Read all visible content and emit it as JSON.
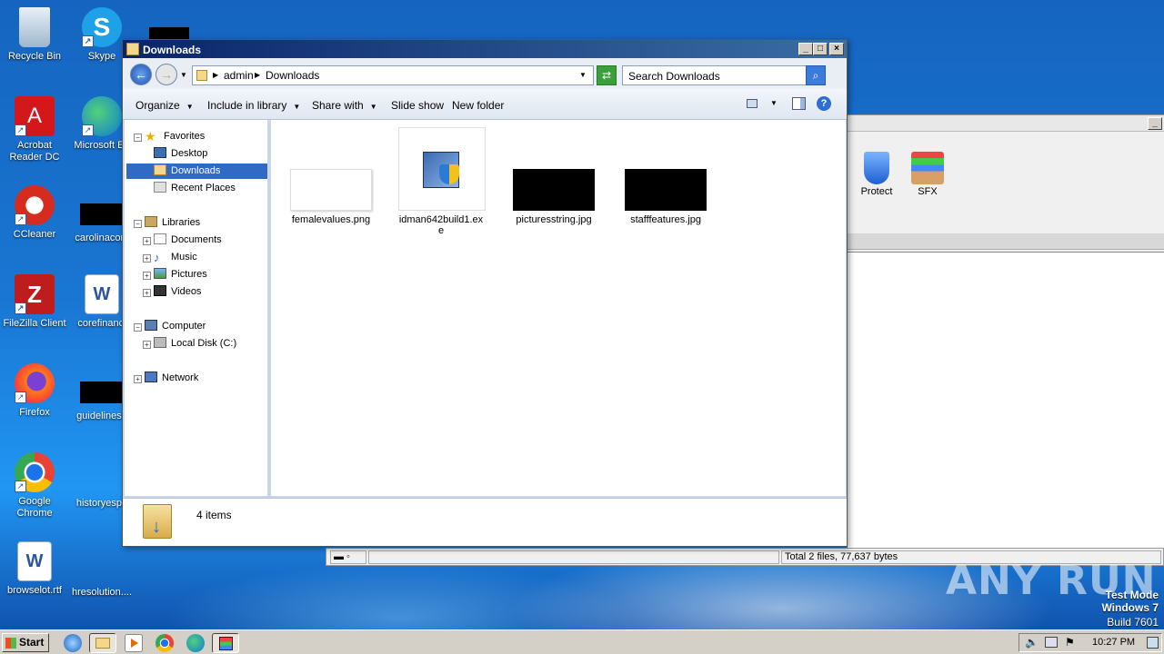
{
  "desktop": {
    "icons": [
      {
        "label": "Recycle Bin"
      },
      {
        "label": "Skype"
      },
      {
        "label": "Acrobat Reader DC"
      },
      {
        "label": "Microsoft Ed"
      },
      {
        "label": "CCleaner"
      },
      {
        "label": "carolinacom"
      },
      {
        "label": "FileZilla Client"
      },
      {
        "label": "corefinanci"
      },
      {
        "label": "Firefox"
      },
      {
        "label": "guidelinesf."
      },
      {
        "label": "Google Chrome"
      },
      {
        "label": "historyespe"
      },
      {
        "label": "browselot.rtf"
      },
      {
        "label": "hresolution...."
      }
    ]
  },
  "bg_app": {
    "toolbar": [
      {
        "label": "Protect"
      },
      {
        "label": "SFX"
      }
    ],
    "status_text": "Total 2 files, 77,637 bytes"
  },
  "explorer": {
    "title": "Downloads",
    "breadcrumb": [
      "admin",
      "Downloads"
    ],
    "search_placeholder": "Search Downloads",
    "commands": {
      "organize": "Organize",
      "include": "Include in library",
      "share": "Share with",
      "slideshow": "Slide show",
      "newfolder": "New folder"
    },
    "nav": {
      "favorites": "Favorites",
      "desktop": "Desktop",
      "downloads": "Downloads",
      "recent": "Recent Places",
      "libraries": "Libraries",
      "documents": "Documents",
      "music": "Music",
      "pictures": "Pictures",
      "videos": "Videos",
      "computer": "Computer",
      "localdisk": "Local Disk (C:)",
      "network": "Network"
    },
    "files": [
      {
        "name": "femalevalues.png"
      },
      {
        "name": "idman642build1.exe"
      },
      {
        "name": "picturesstring.jpg"
      },
      {
        "name": "stafffeatures.jpg"
      }
    ],
    "item_count": "4 items"
  },
  "watermark": {
    "line1": "Test Mode",
    "line2": "Windows 7",
    "line3": "Build 7601",
    "brand": "ANY RUN"
  },
  "taskbar": {
    "start": "Start",
    "clock": "10:27 PM"
  }
}
